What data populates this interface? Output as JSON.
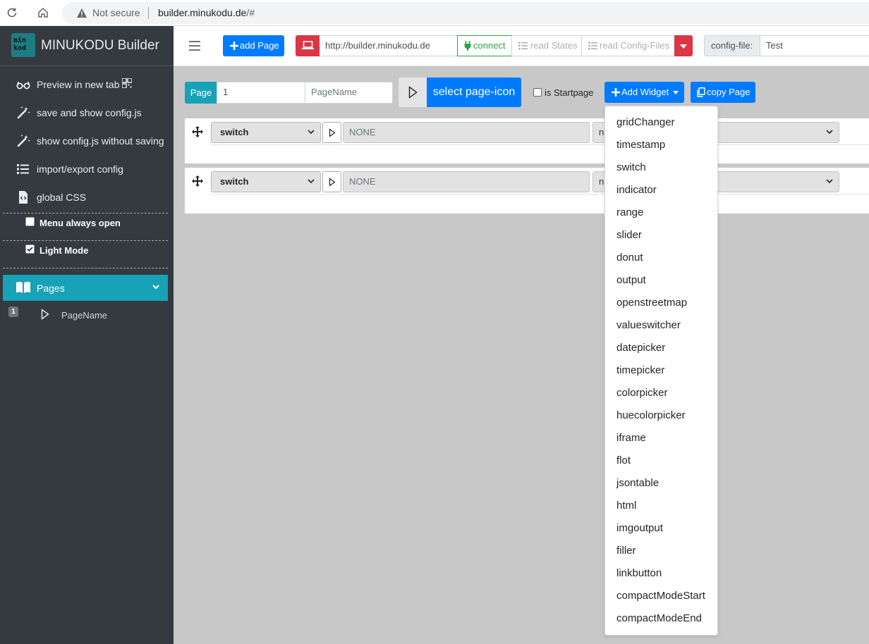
{
  "browser": {
    "not_secure": "Not secure",
    "url_host": "builder.minukodu.de",
    "url_path": "/#"
  },
  "sidebar": {
    "logo_text": "minkod",
    "brand": "MINUKODU Builder",
    "items": [
      {
        "label": "Preview in new tab",
        "icon": "glasses-icon"
      },
      {
        "label": "save and show config.js",
        "icon": "magic-wand-icon"
      },
      {
        "label": "show config.js without saving",
        "icon": "magic-wand-icon"
      },
      {
        "label": "import/export config",
        "icon": "list-icon"
      },
      {
        "label": "global CSS",
        "icon": "code-file-icon"
      }
    ],
    "menu_always_open": {
      "label": "Menu always open",
      "checked": false
    },
    "light_mode": {
      "label": "Light Mode",
      "checked": true
    },
    "pages": {
      "label": "Pages",
      "page_number": "1",
      "page_name": "PageName"
    }
  },
  "topnav": {
    "add_page": "add Page",
    "server_url": "http://builder.minukodu.de",
    "connect": "connect",
    "read_states": "read States",
    "read_config_files": "read Config-Files",
    "config_file_label": "config-file:",
    "config_file_value": "Test"
  },
  "page_toolbar": {
    "page_label": "Page",
    "page_number": "1",
    "page_name_placeholder": "PageName",
    "select_icon": "select page-icon",
    "is_startpage": "is Startpage",
    "add_widget": "Add Widget",
    "copy_page": "copy Page"
  },
  "widgets": [
    {
      "type": "switch",
      "state": "NONE",
      "partial": "n"
    },
    {
      "type": "switch",
      "state": "NONE",
      "partial": "n"
    }
  ],
  "dropdown": [
    "gridChanger",
    "timestamp",
    "switch",
    "indicator",
    "range",
    "slider",
    "donut",
    "output",
    "openstreetmap",
    "valueswitcher",
    "datepicker",
    "timepicker",
    "colorpicker",
    "huecolorpicker",
    "iframe",
    "flot",
    "jsontable",
    "html",
    "imgoutput",
    "filler",
    "linkbutton",
    "compactModeStart",
    "compactModeEnd"
  ],
  "colors": {
    "primary": "#007bff",
    "danger": "#dc3545",
    "info": "#17a2b8",
    "success": "#28a745",
    "sidebar": "#343a40"
  }
}
